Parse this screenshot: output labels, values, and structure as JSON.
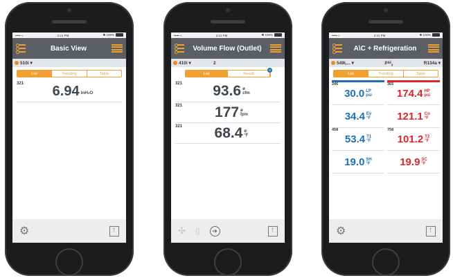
{
  "phones": [
    {
      "status": {
        "signal": "••••• ≈",
        "time": "2:21 PM",
        "battery": "✱ 100%"
      },
      "header": {
        "title": "Basic View"
      },
      "probe": {
        "name": "510i ▾"
      },
      "tabs": [
        "List",
        "Trending",
        "Table"
      ],
      "readings": [
        {
          "id": "321",
          "value": "6.94",
          "unit": "inH",
          "unit_sub": "2",
          "unit_tail": "O"
        }
      ]
    },
    {
      "status": {
        "signal": "••••• ≈",
        "time": "2:21 PM",
        "battery": "✱ 100%"
      },
      "header": {
        "title": "Volume Flow (Outlet)"
      },
      "probe": {
        "name": "410i ▾",
        "count": "2"
      },
      "tabs": [
        "List",
        "Result"
      ],
      "badge": "0",
      "readings": [
        {
          "id": "321",
          "value": "93.6",
          "sym": "ø",
          "unit": "cfm"
        },
        {
          "id": "321",
          "value": "177",
          "sym": "ø",
          "unit": "fpm"
        },
        {
          "id": "321",
          "value": "68.4",
          "sym": "ø",
          "unit": "°F"
        }
      ]
    },
    {
      "status": {
        "signal": "••••• ≈",
        "time": "2:21 PM",
        "battery": "✱ 100%"
      },
      "header": {
        "title": "A\\C + Refrigeration"
      },
      "probe": {
        "name": "549i,... ▾",
        "unit": "psi",
        "unit_sub": "g",
        "refrigerant": "R134a ▾"
      },
      "tabs": [
        "List",
        "Trending",
        "Table"
      ],
      "left_id_1": "246",
      "right_id_1": "365",
      "left_id_2": "458",
      "right_id_2": "758",
      "cells": [
        {
          "value": "30.0",
          "label": "LP",
          "unit": "psi"
        },
        {
          "value": "174.4",
          "label": "HP",
          "unit": "psi"
        },
        {
          "value": "34.4",
          "label": "Ev",
          "unit": "°F"
        },
        {
          "value": "121.1",
          "label": "Co",
          "unit": "°F"
        },
        {
          "value": "53.4",
          "label": "T1",
          "unit": "°F"
        },
        {
          "value": "101.2",
          "label": "T2",
          "unit": "°F"
        },
        {
          "value": "19.0",
          "label": "SH",
          "unit": "°F"
        },
        {
          "value": "19.9",
          "label": "SC",
          "unit": "°F"
        }
      ]
    }
  ],
  "colors": {
    "accent": "#f0a030",
    "header": "#5b5f63",
    "blue": "#1f6fb5",
    "red": "#d8262c"
  }
}
